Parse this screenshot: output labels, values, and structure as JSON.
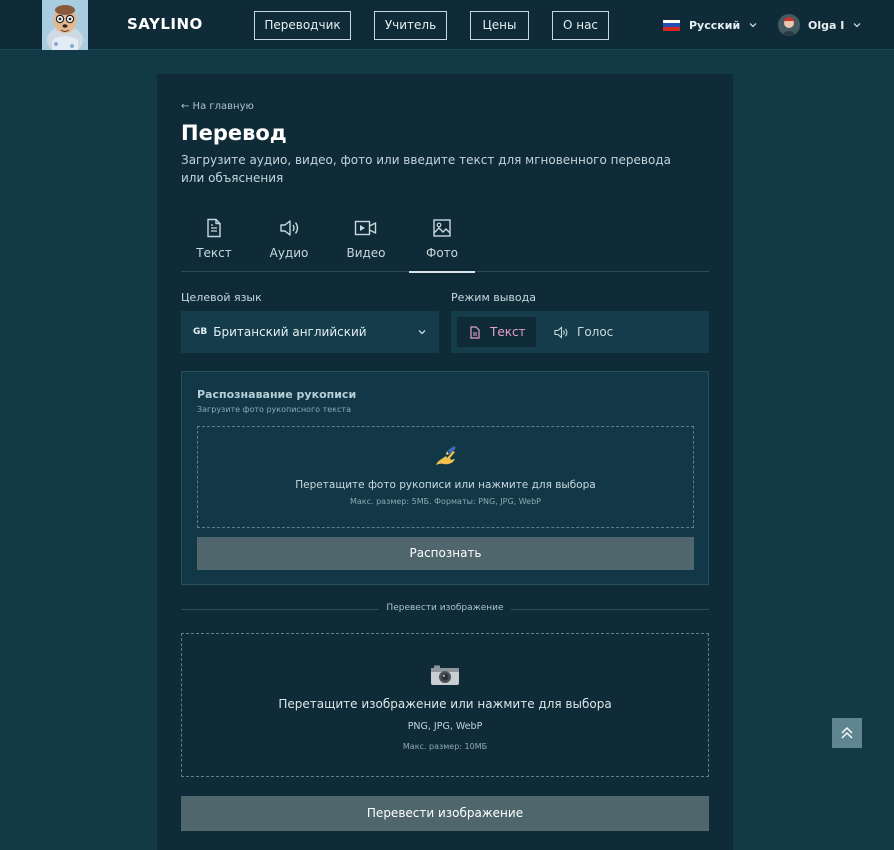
{
  "header": {
    "brand": "SAYLINO",
    "nav": [
      {
        "label": "Переводчик"
      },
      {
        "label": "Учитель"
      },
      {
        "label": "Цены"
      },
      {
        "label": "О нас"
      }
    ],
    "language": "Русский",
    "user_name": "Olga I"
  },
  "page": {
    "back_link": "← На главную",
    "title": "Перевод",
    "subtitle": "Загрузите аудио, видео, фото или введите текст для мгновенного перевода или объяснения"
  },
  "tabs": [
    {
      "label": "Текст",
      "icon": "document-icon"
    },
    {
      "label": "Аудио",
      "icon": "speaker-icon"
    },
    {
      "label": "Видео",
      "icon": "video-icon"
    },
    {
      "label": "Фото",
      "icon": "image-icon",
      "active": true
    }
  ],
  "target_language": {
    "label": "Целевой язык",
    "code": "GB",
    "value": "Британский английский"
  },
  "output_mode": {
    "label": "Режим вывода",
    "options": [
      {
        "label": "Текст",
        "selected": true
      },
      {
        "label": "Голос",
        "selected": false
      }
    ]
  },
  "handwriting": {
    "title": "Распознавание рукописи",
    "subtitle": "Загрузите фото рукописного текста",
    "drop_text": "Перетащите фото рукописи или нажмите для выбора",
    "drop_hint": "Макс. размер: 5МБ. Форматы: PNG, JPG, WebP",
    "button": "Распознать"
  },
  "divider_text": "Перевести изображение",
  "image_translate": {
    "drop_text": "Перетащите изображение или нажмите для выбора",
    "formats": "PNG, JPG, WebP",
    "max_size": "Макс. размер: 10МБ",
    "button": "Перевести изображение"
  },
  "colors": {
    "background": "#123a46",
    "card": "#0f2b38",
    "accent_pink": "#e7a0c8",
    "button": "#4e666c"
  }
}
